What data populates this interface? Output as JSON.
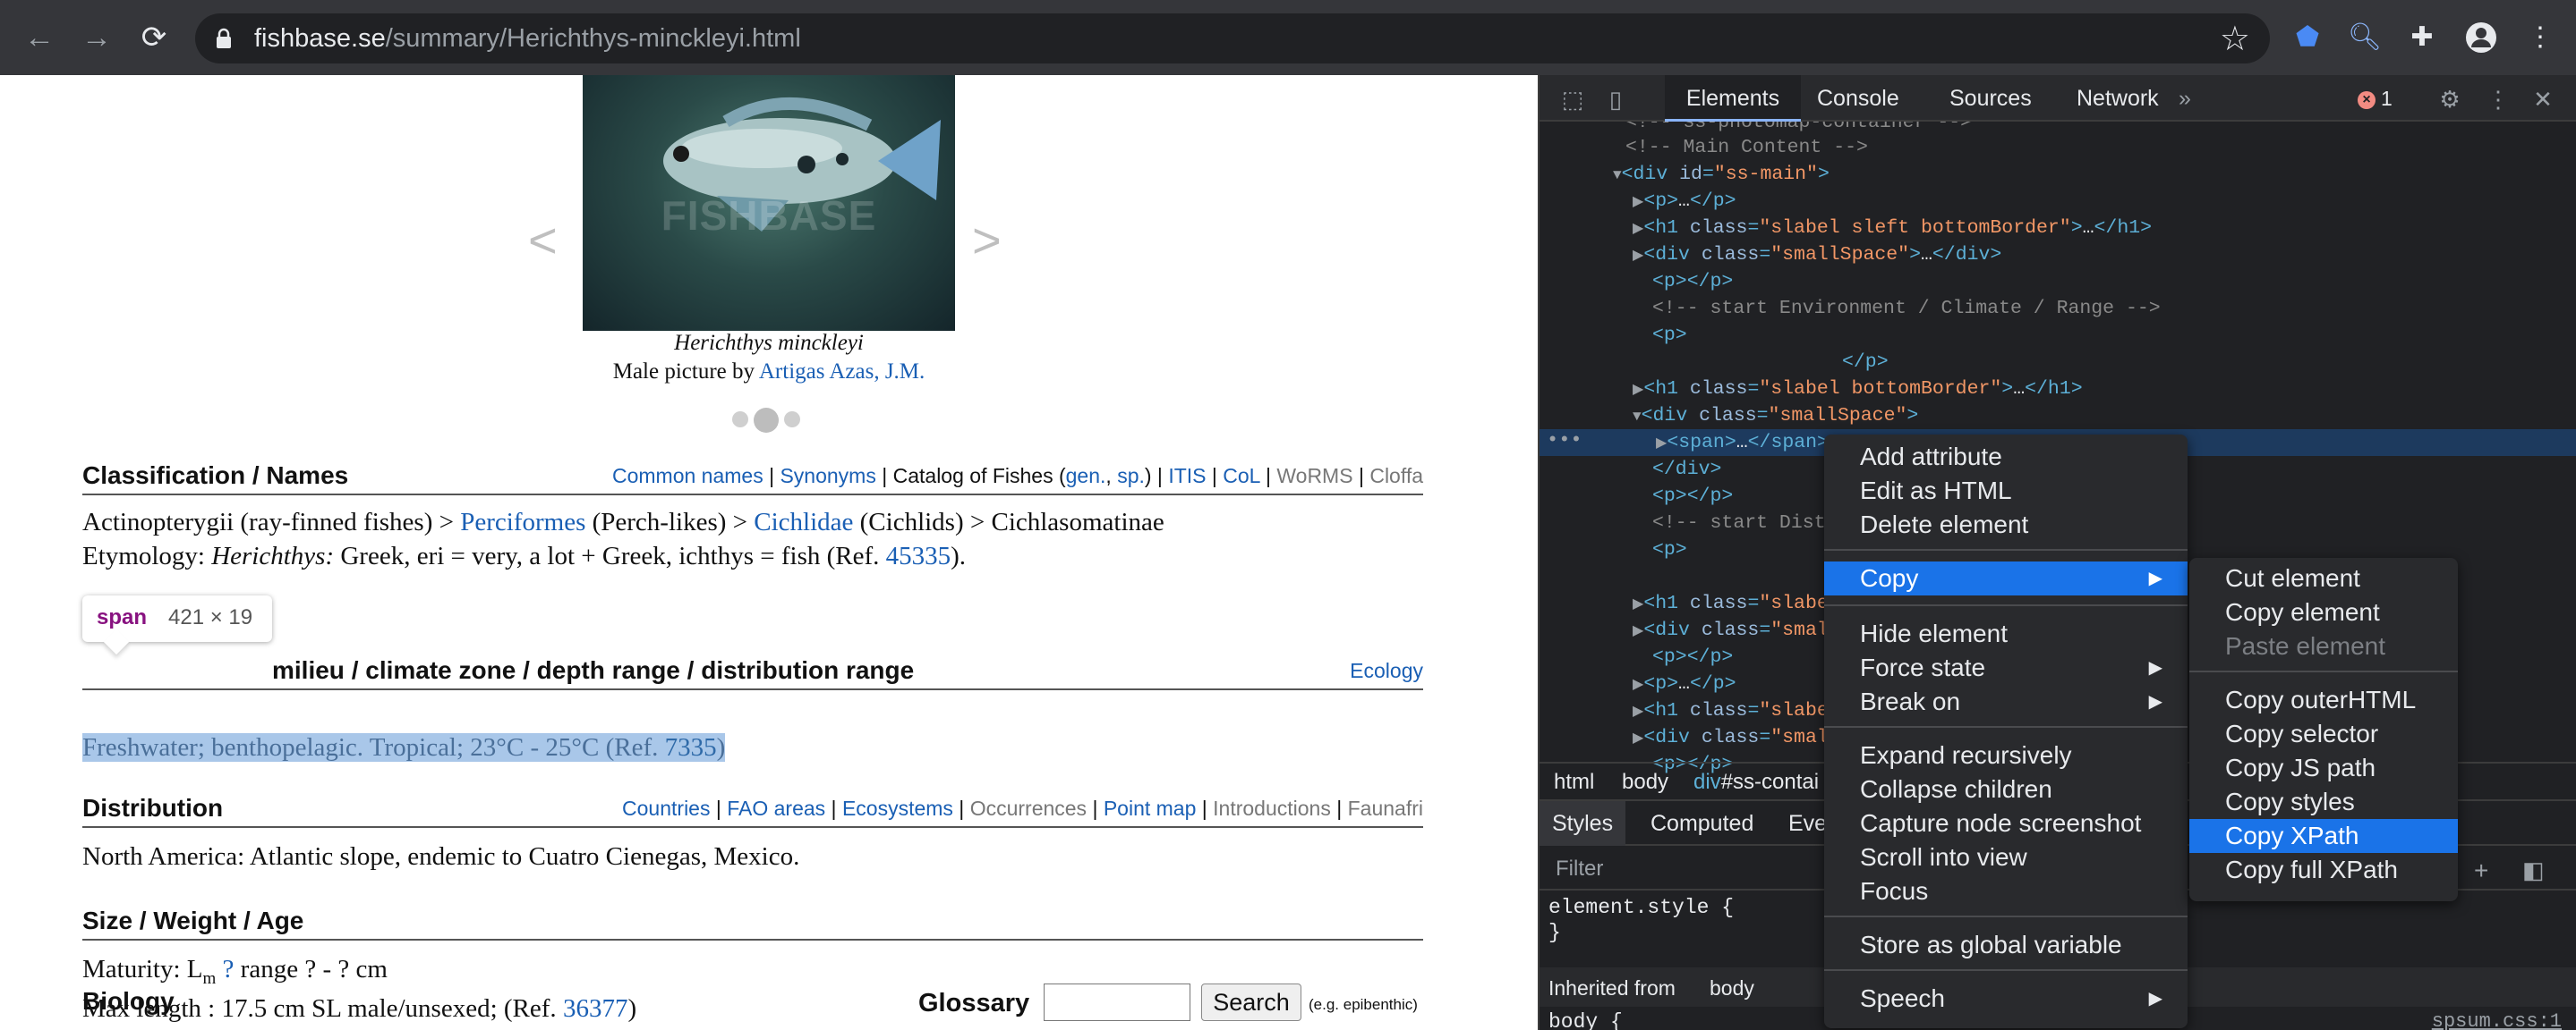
{
  "browser": {
    "url_host": "fishbase.se",
    "url_path": "/summary/Herichthys-minckleyi.html"
  },
  "page": {
    "caption_species": "Herichthys minckleyi",
    "caption_prefix": "Male picture by ",
    "caption_author": "Artigas Azas, J.M.",
    "photo_watermark": "FISHBASE",
    "classification": {
      "title": "Classification / Names",
      "links": {
        "common_names": "Common names",
        "synonyms": "Synonyms",
        "catalog_prefix": "Catalog of Fishes (",
        "gen": "gen.",
        "sp": "sp.",
        "catalog_suffix": ")",
        "itis": "ITIS",
        "col": "CoL",
        "worms": "WoRMS",
        "cloffa": "Cloffa"
      },
      "line1_a": "Actinopterygii (ray-finned fishes) > ",
      "perciformes": "Perciformes",
      "line1_b": " (Perch-likes) > ",
      "cichlidae": "Cichlidae",
      "line1_c": " (Cichlids) > Cichlasomatinae",
      "etym_label": "Etymology: ",
      "etym_genus": "Herichthys:",
      "etym_text": " Greek, eri = very, a lot + Greek, ichthys = fish (Ref. ",
      "etym_ref": "45335",
      "etym_end": ")."
    },
    "environment": {
      "title": "milieu / climate zone / depth range / distribution range",
      "link": "Ecology",
      "text": "Freshwater; benthopelagic.   Tropical; 23°C - 25°C (Ref. ",
      "ref": "7335",
      "end": ")"
    },
    "tooltip": {
      "tag": "span",
      "dims": "421 × 19"
    },
    "distribution": {
      "title": "Distribution",
      "links": {
        "countries": "Countries",
        "fao": "FAO areas",
        "ecosystems": "Ecosystems",
        "occurrences": "Occurrences",
        "pointmap": "Point map",
        "introductions": "Introductions",
        "faunafri": "Faunafri"
      },
      "text": "North America: Atlantic slope, endemic to Cuatro Cienegas, Mexico."
    },
    "size": {
      "title": "Size / Weight / Age",
      "maturity_label": "Maturity: L",
      "maturity_sub": "m",
      "maturity_q": "?",
      "maturity_rest": "  range ? - ? cm",
      "maxlen": "Max length : 17.5 cm SL male/unsexed; (Ref. ",
      "maxlen_ref": "36377",
      "maxlen_end": ")"
    },
    "biology": {
      "title": "Biology"
    },
    "glossary": {
      "label": "Glossary",
      "button": "Search",
      "example": "(e.g. epibenthic)"
    }
  },
  "devtools": {
    "tabs": [
      "Elements",
      "Console",
      "Sources",
      "Network",
      "»"
    ],
    "error_count": "1",
    "breadcrumbs": {
      "html": "html",
      "body": "body",
      "div_tag": "div",
      "div_id": "#ss-contai"
    },
    "styles_tabs": [
      "Styles",
      "Computed",
      "Eve"
    ],
    "filter_placeholder": "Filter",
    "element_style": "element.style {",
    "close_brace": "}",
    "inherited_label": "Inherited from ",
    "inherited_from": "body",
    "body_rule": "body {",
    "stylesheet": "spsum.css:1"
  },
  "context_menu": {
    "items": [
      "Add attribute",
      "Edit as HTML",
      "Delete element",
      "Copy",
      "Hide element",
      "Force state",
      "Break on",
      "Expand recursively",
      "Collapse children",
      "Capture node screenshot",
      "Scroll into view",
      "Focus",
      "Store as global variable",
      "Speech"
    ],
    "highlighted": "Copy"
  },
  "copy_submenu": {
    "items": [
      "Cut element",
      "Copy element",
      "Paste element",
      "Copy outerHTML",
      "Copy selector",
      "Copy JS path",
      "Copy styles",
      "Copy XPath",
      "Copy full XPath"
    ],
    "highlighted": "Copy XPath",
    "disabled": "Paste element"
  },
  "colors": {
    "accent": "#1a73e8",
    "link": "#1a5fb4",
    "selection": "#a9c7e9"
  },
  "icons": [
    "back-arrow-icon",
    "forward-arrow-icon",
    "reload-icon",
    "lock-icon",
    "star-icon",
    "extension-icon",
    "profile-icon",
    "kebab-menu-icon"
  ]
}
